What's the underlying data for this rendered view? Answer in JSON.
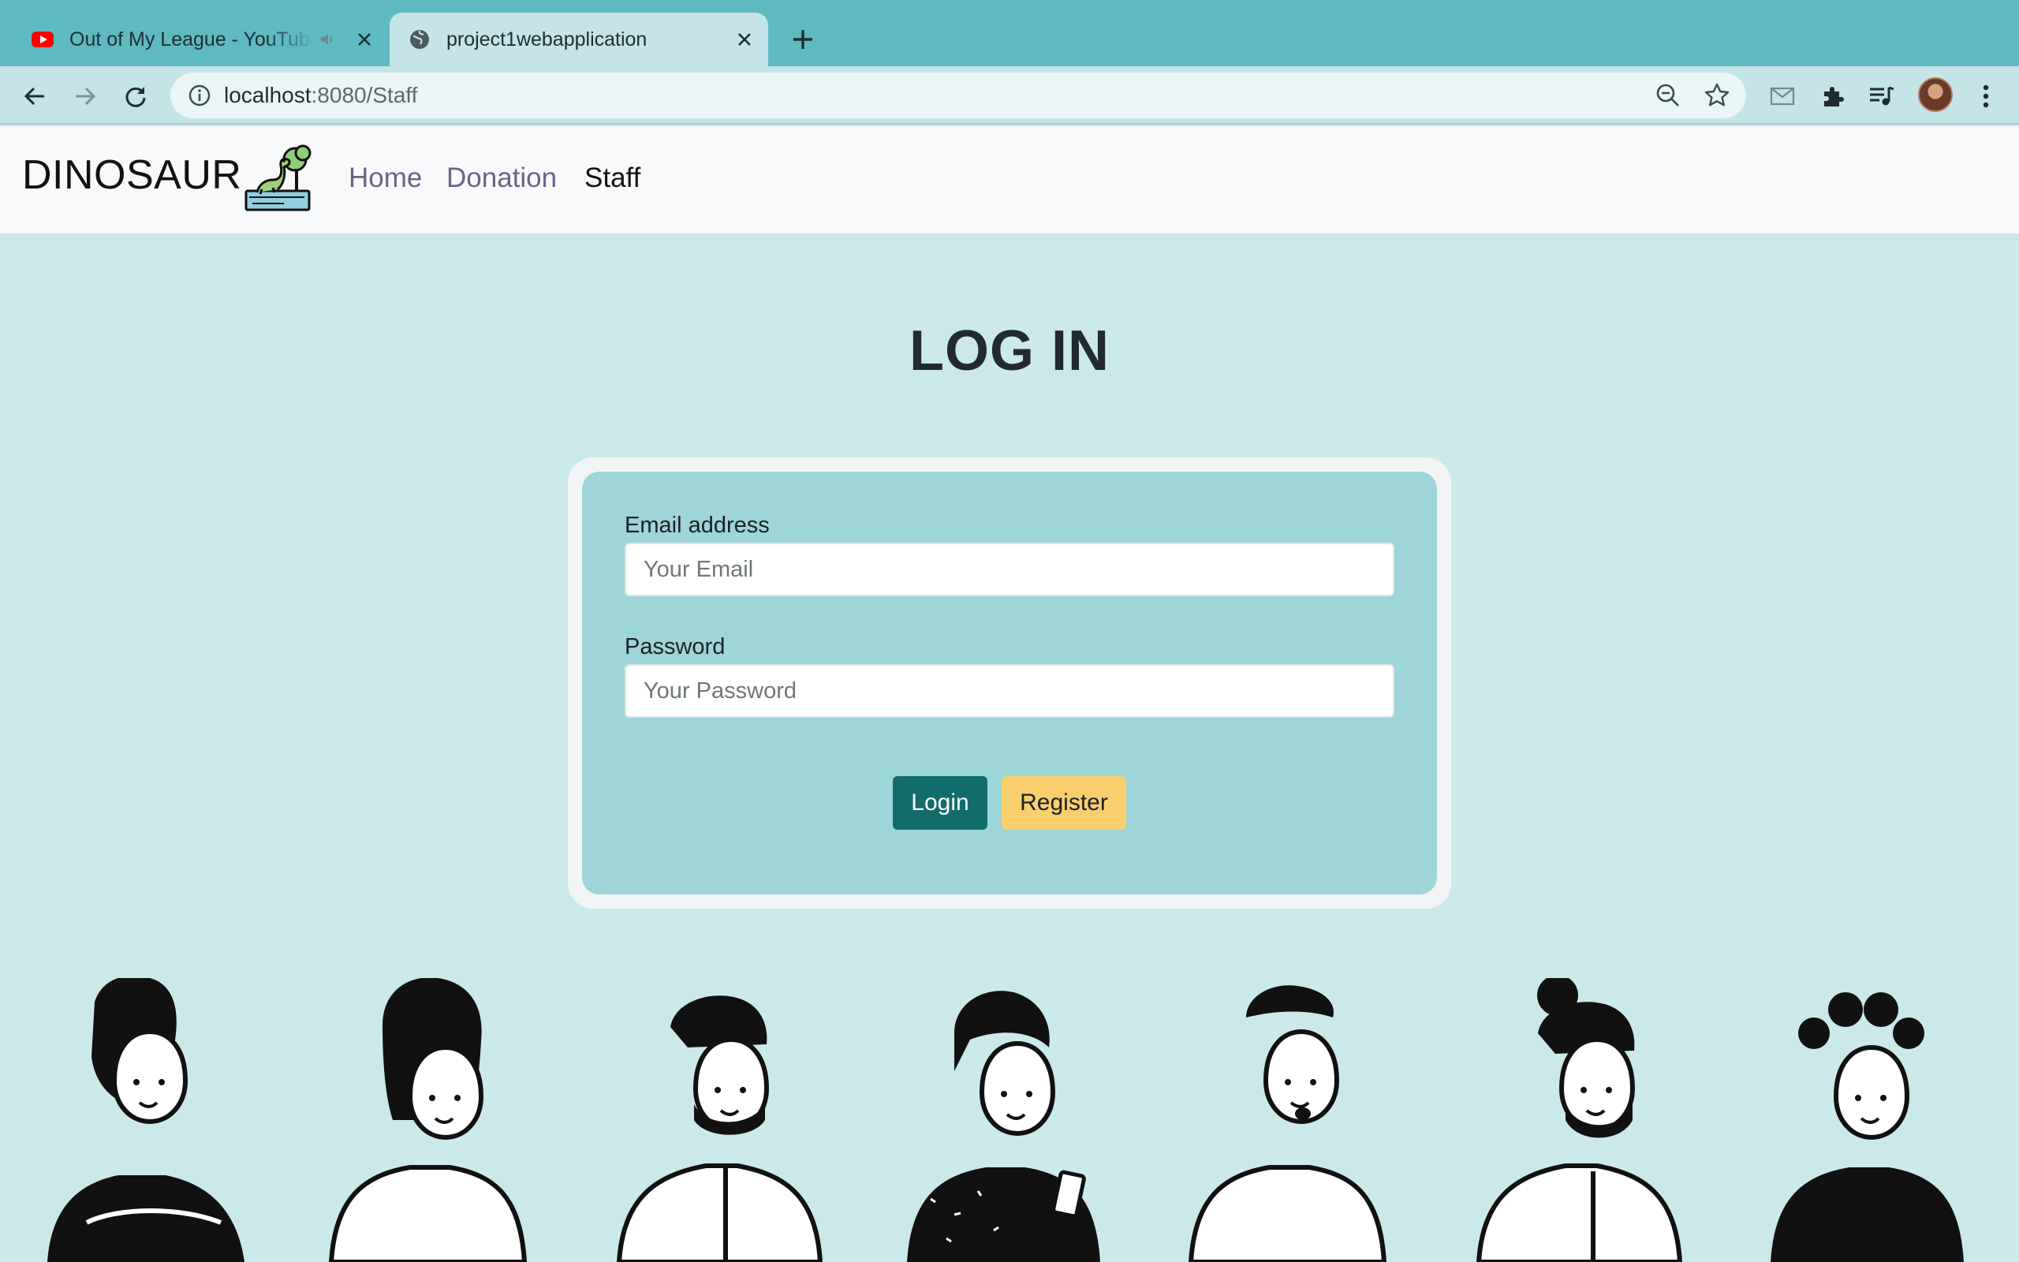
{
  "browser": {
    "tabs": [
      {
        "title": "Out of My League - YouTube",
        "favicon": "youtube-icon",
        "audio": true,
        "active": false
      },
      {
        "title": "project1webapplication",
        "favicon": "globe-icon",
        "active": true
      }
    ],
    "url_host": "localhost",
    "url_path": ":8080/Staff"
  },
  "navbar": {
    "brand": "DINOSAUR",
    "links": [
      "Home",
      "Donation",
      "Staff"
    ],
    "active_link": "Staff"
  },
  "page": {
    "title": "LOG IN"
  },
  "form": {
    "email_label": "Email address",
    "email_placeholder": "Your Email",
    "email_value": "",
    "password_label": "Password",
    "password_placeholder": "Your Password",
    "password_value": "",
    "login_label": "Login",
    "register_label": "Register"
  },
  "colors": {
    "page_bg": "#cce9e9",
    "card_bg": "#9dd5d8",
    "login_btn": "#136c6c",
    "register_btn": "#f9cf6e",
    "tab_strip": "#5fb9c1"
  }
}
